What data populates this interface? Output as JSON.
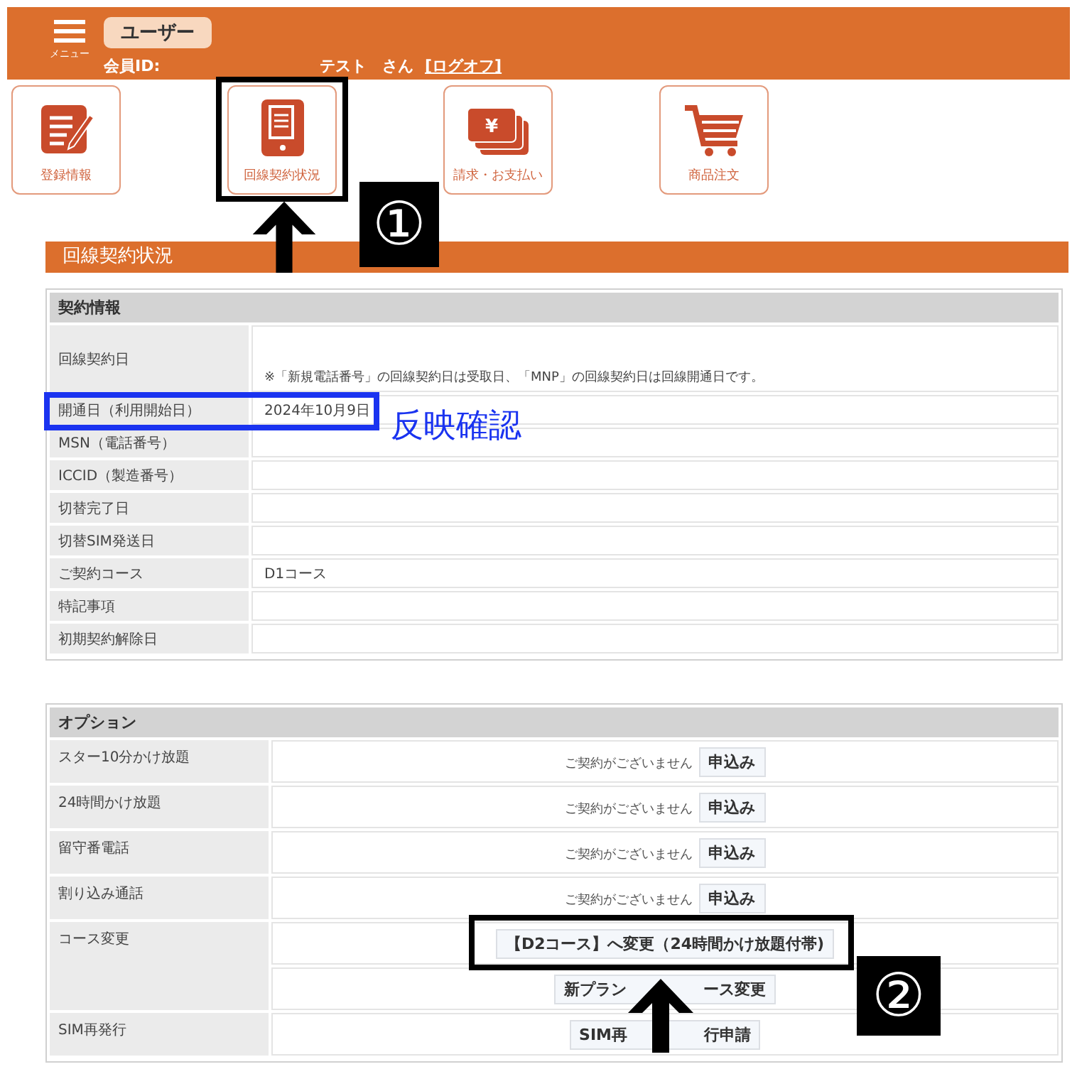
{
  "header": {
    "menu_label": "メニュー",
    "user_badge": "ユーザー",
    "member_id_label": "会員ID:",
    "user_name": "テスト　さん",
    "logoff_link": "[ログオフ]"
  },
  "nav_tiles": [
    {
      "label": "登録情報",
      "kind": "register"
    },
    {
      "label": "回線契約状況",
      "kind": "contract"
    },
    {
      "label": "請求・お支払い",
      "kind": "billing",
      "icon_symbol": "¥"
    },
    {
      "label": "商品注文",
      "kind": "order"
    }
  ],
  "section_title": "回線契約状況",
  "contract_info": {
    "title": "契約情報",
    "rows": [
      {
        "label": "回線契約日",
        "note": "※「新規電話番号」の回線契約日は受取日、「MNP」の回線契約日は回線開通日です。"
      },
      {
        "label": "開通日（利用開始日）",
        "value": "2024年10月9日"
      },
      {
        "label": "MSN（電話番号）"
      },
      {
        "label": "ICCID（製造番号）"
      },
      {
        "label": "切替完了日"
      },
      {
        "label": "切替SIM発送日"
      },
      {
        "label": "ご契約コース",
        "value": "D1コース"
      },
      {
        "label": "特記事項"
      },
      {
        "label": "初期契約解除日"
      }
    ]
  },
  "options": {
    "title": "オプション",
    "rows": [
      {
        "label": "スター10分かけ放題",
        "kind": "apply",
        "status": "ご契約がございません",
        "button": "申込み"
      },
      {
        "label": "24時間かけ放題",
        "kind": "apply",
        "status": "ご契約がございません",
        "button": "申込み"
      },
      {
        "label": "留守番電話",
        "kind": "apply",
        "status": "ご契約がございません",
        "button": "申込み"
      },
      {
        "label": "割り込み通話",
        "kind": "apply",
        "status": "ご契約がございません",
        "button": "申込み"
      },
      {
        "label": "コース変更",
        "kind": "buttons",
        "buttons": [
          {
            "text": "【D2コース】へ変更（24時間かけ放題付帯)"
          },
          {
            "text": "新プラン",
            "text_after_arrow": "ース変更"
          }
        ]
      },
      {
        "label": "SIM再発行",
        "kind": "buttons",
        "buttons": [
          {
            "text": "SIM再",
            "text_after_arrow": "行申請"
          }
        ]
      }
    ]
  },
  "annotations": {
    "step_labels": [
      "①",
      "②"
    ],
    "note": "反映確認"
  }
}
